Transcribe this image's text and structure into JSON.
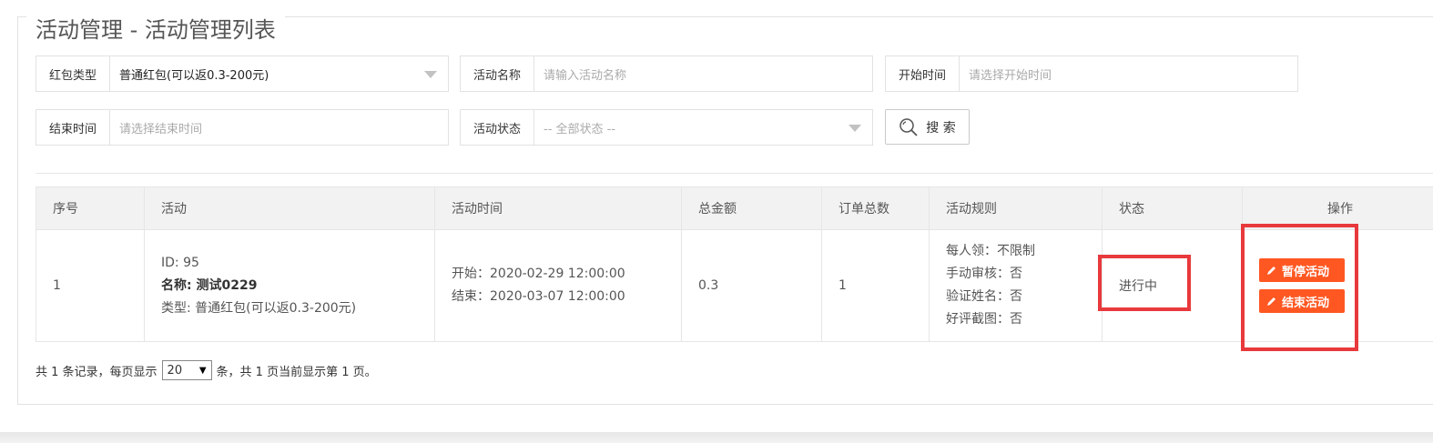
{
  "page": {
    "title": "活动管理 - 活动管理列表"
  },
  "filters": {
    "red_type": {
      "label": "红包类型",
      "value": "普通红包(可以返0.3-200元)"
    },
    "name": {
      "label": "活动名称",
      "placeholder": "请输入活动名称"
    },
    "start_time": {
      "label": "开始时间",
      "placeholder": "请选择开始时间"
    },
    "end_time": {
      "label": "结束时间",
      "placeholder": "请选择结束时间"
    },
    "status": {
      "label": "活动状态",
      "value": "-- 全部状态 --"
    },
    "search_label": "搜 索"
  },
  "table": {
    "headers": [
      "序号",
      "活动",
      "活动时间",
      "总金额",
      "订单总数",
      "活动规则",
      "状态",
      "操作"
    ],
    "rows": [
      {
        "index": "1",
        "activity": {
          "id": "ID: 95",
          "name_label": "名称: ",
          "name": "测试0229",
          "type": "类型: 普通红包(可以返0.3-200元)"
        },
        "time": {
          "start": "开始：2020-02-29 12:00:00",
          "end": "结束：2020-03-07 12:00:00"
        },
        "amount": "0.3",
        "orders": "1",
        "rules": [
          "每人领：不限制",
          "手动审核：否",
          "验证姓名：否",
          "好评截图：否"
        ],
        "status": "进行中",
        "actions": {
          "pause": "暂停活动",
          "end": "结束活动"
        }
      }
    ]
  },
  "pager": {
    "prefix": "共 1 条记录，每页显示",
    "page_size": "20",
    "suffix": "条，共 1 页当前显示第 1 页。"
  },
  "colors": {
    "accent": "#ff5722",
    "highlight": "#e8393c"
  }
}
